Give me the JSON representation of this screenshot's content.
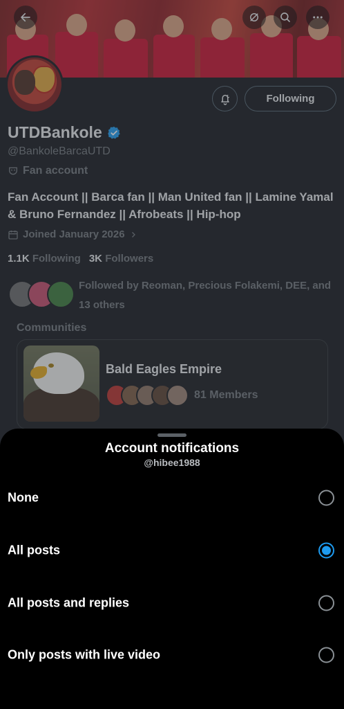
{
  "profile": {
    "following_button": "Following",
    "display_name": "UTDBankole",
    "handle": "@BankoleBarcaUTD",
    "fan_label": "Fan account",
    "bio": "Fan Account || Barca fan || Man United fan || Lamine Yamal & Bruno Fernandez || Afrobeats || Hip-hop",
    "joined": "Joined January 2026",
    "following_count": "1.1K",
    "following_label": "Following",
    "followers_count": "3K",
    "followers_label": "Followers",
    "followed_by": "Followed by Reoman, Precious Folakemi, DEE, and 13 others",
    "communities_title": "Communities",
    "community": {
      "name": "Bald Eagles Empire",
      "members": "81 Members"
    },
    "verified_color": "#1d9bf0"
  },
  "sheet": {
    "title": "Account notifications",
    "subtitle": "@hibee1988",
    "options": [
      {
        "label": "None",
        "selected": false
      },
      {
        "label": "All posts",
        "selected": true
      },
      {
        "label": "All posts and replies",
        "selected": false
      },
      {
        "label": "Only posts with live video",
        "selected": false
      }
    ],
    "accent_color": "#1d9bf0"
  },
  "icons": {
    "back": "arrow-left-icon",
    "grok": "grok-icon",
    "search": "search-icon",
    "more": "more-icon",
    "bell": "bell-icon",
    "verified": "verified-badge-icon",
    "fan": "mask-icon",
    "calendar": "calendar-icon"
  }
}
